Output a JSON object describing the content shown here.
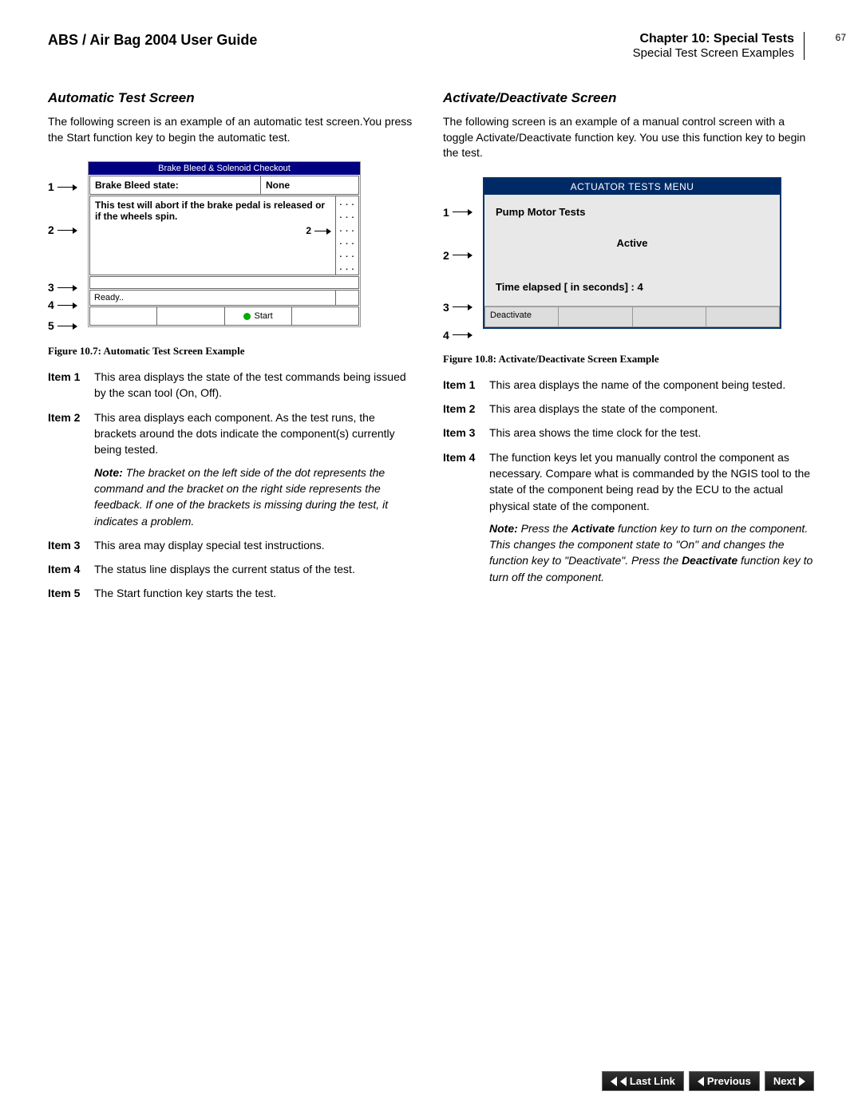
{
  "header": {
    "doc_title": "ABS / Air Bag 2004 User Guide",
    "chapter": "Chapter 10: Special Tests",
    "subtitle": "Special Test Screen Examples",
    "page_num": "67"
  },
  "left": {
    "title": "Automatic Test Screen",
    "intro": "The following screen is an example of an automatic test screen.You press the Start function key to begin the automatic test.",
    "caption": "Figure 10.7: Automatic Test Screen Example",
    "screen": {
      "title": "Brake Bleed & Solenoid Checkout",
      "state_label": "Brake Bleed state:",
      "state_value": "None",
      "message": "This test will abort if the brake pedal is released or if the wheels spin.",
      "inner_callout": "2",
      "dots": ". . .",
      "status": "Ready..",
      "start_label": "Start"
    },
    "items": [
      {
        "label": "Item 1",
        "text": "This area displays the state of the test commands being issued by the scan tool (On, Off)."
      },
      {
        "label": "Item 2",
        "text": "This area displays each component. As the test runs, the brackets around the dots indicate the component(s) currently being tested.",
        "note": "The bracket on the left side of the dot represents the command and the bracket on the right side represents the feedback. If one of the brackets is missing during the test, it indicates a problem."
      },
      {
        "label": "Item 3",
        "text": "This area may display special test instructions."
      },
      {
        "label": "Item 4",
        "text": "The status line displays the current status of the test."
      },
      {
        "label": "Item 5",
        "text": "The Start function key starts the test."
      }
    ],
    "callouts": [
      "1",
      "2",
      "3",
      "4",
      "5"
    ]
  },
  "right": {
    "title": "Activate/Deactivate Screen",
    "intro": "The following screen is an example of a manual control screen with a toggle Activate/Deactivate function key. You use this function key to begin the test.",
    "caption": "Figure 10.8: Activate/Deactivate Screen Example",
    "screen": {
      "title": "ACTUATOR TESTS MENU",
      "component_name": "Pump Motor Tests",
      "state": "Active",
      "time_label": "Time elapsed [ in seconds] : 4",
      "fn_label": "Deactivate"
    },
    "items": [
      {
        "label": "Item 1",
        "text": "This area displays the name of the component being tested."
      },
      {
        "label": "Item 2",
        "text": "This area displays the state of the component."
      },
      {
        "label": "Item 3",
        "text": "This area shows the time clock for the test."
      },
      {
        "label": "Item 4",
        "text": "The function keys let you manually control the component as necessary. Compare what is commanded by the NGIS tool to the state of the component being read by the ECU to the actual physical state of the component.",
        "note_html": "Press the <b>Activate</b> function key to turn on the component. This changes the component state to \"On\" and changes the function key to \"Deactivate\". Press the <b>Deactivate</b> function key to turn off the component."
      }
    ],
    "callouts": [
      "1",
      "2",
      "3",
      "4"
    ]
  },
  "nav": {
    "last_link": "Last Link",
    "previous": "Previous",
    "next": "Next"
  }
}
